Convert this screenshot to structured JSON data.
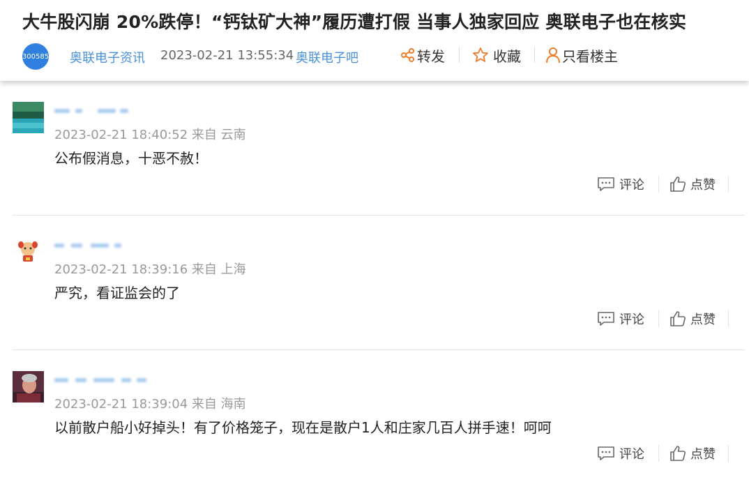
{
  "article": {
    "title": "大牛股闪崩 20%跌停！“钙钛矿大神”履历遭打假 当事人独家回应 奥联电子也在核实",
    "stock_code": "300585",
    "source": "奥联电子资讯",
    "timestamp": "2023-02-21 13:55:34",
    "bar_name": "奥联电子吧"
  },
  "actions": {
    "share_label": "转发",
    "favorite_label": "收藏",
    "only_host_label": "只看楼主"
  },
  "colors": {
    "accent_orange": "#f07c2a",
    "link_blue": "#4a90d9",
    "badge_blue": "#2f7fe0"
  },
  "comments": [
    {
      "time_location": "2023-02-21 18:40:52 来自 云南",
      "text": "公布假消息，十恶不赦！",
      "comment_label": "评论",
      "like_label": "点赞"
    },
    {
      "time_location": "2023-02-21 18:39:16 来自 上海",
      "text": "严究，看证监会的了",
      "comment_label": "评论",
      "like_label": "点赞"
    },
    {
      "time_location": "2023-02-21 18:39:04 来自 海南",
      "text": "以前散户船小好掉头！有了价格笼子，现在是散户1人和庄家几百人拼手速！呵呵",
      "comment_label": "评论",
      "like_label": "点赞"
    }
  ]
}
